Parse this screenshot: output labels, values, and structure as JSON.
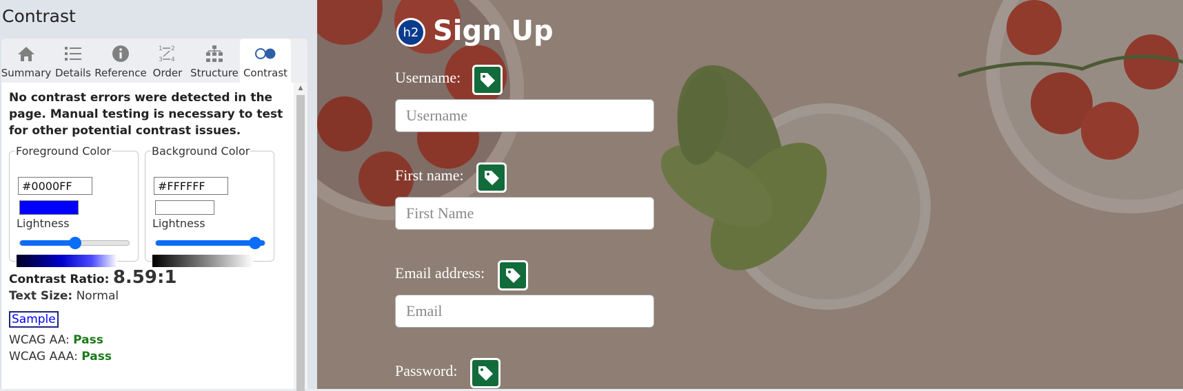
{
  "panel": {
    "title": "Contrast",
    "tabs": [
      {
        "label": "Summary",
        "icon": "home-icon"
      },
      {
        "label": "Details",
        "icon": "list-icon"
      },
      {
        "label": "Reference",
        "icon": "info-icon"
      },
      {
        "label": "Order",
        "icon": "order-icon"
      },
      {
        "label": "Structure",
        "icon": "structure-icon"
      },
      {
        "label": "Contrast",
        "icon": "contrast-icon",
        "active": true
      }
    ],
    "message": "No contrast errors were detected in the page. Manual testing is necessary to test for other potential contrast issues.",
    "foreground": {
      "legend": "Foreground Color",
      "hex": "#0000FF",
      "lightness_label": "Lightness",
      "lightness": 0.5
    },
    "background": {
      "legend": "Background Color",
      "hex": "#FFFFFF",
      "lightness_label": "Lightness",
      "lightness": 1.0
    },
    "ratio_label": "Contrast Ratio:",
    "ratio_value": "8.59:1",
    "text_size_label": "Text Size:",
    "text_size_value": "Normal",
    "sample_text": "Sample",
    "wcag_aa_label": "WCAG AA:",
    "wcag_aa_value": "Pass",
    "wcag_aaa_label": "WCAG AAA:",
    "wcag_aaa_value": "Pass",
    "pass_color": "#1a7a1a"
  },
  "page": {
    "logo_text": "h2",
    "title": "Sign Up",
    "fields": [
      {
        "label": "Username:",
        "placeholder": "Username"
      },
      {
        "label": "First name:",
        "placeholder": "First Name"
      },
      {
        "label": "Email address:",
        "placeholder": "Email"
      },
      {
        "label": "Password:",
        "placeholder": ""
      }
    ],
    "tag_color": "#126b3a"
  }
}
